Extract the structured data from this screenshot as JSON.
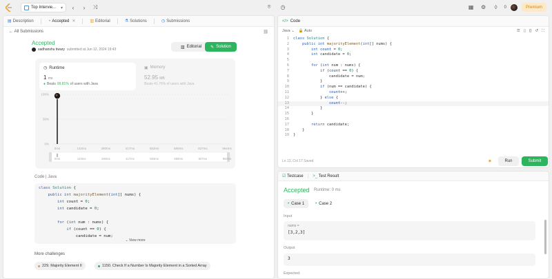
{
  "topbar": {
    "tab_title": "Top Intervie...",
    "premium_label": "Premium"
  },
  "left": {
    "tabs": [
      {
        "label": "Description"
      },
      {
        "label": "Accepted"
      },
      {
        "label": "Editorial"
      },
      {
        "label": "Solutions"
      },
      {
        "label": "Submissions"
      }
    ],
    "back_label": "All Submissions",
    "status": "Accepted",
    "author": "sadhanshu tiwary",
    "submitted": "submitted at Jun 12, 2024 19:43",
    "editorial_btn": "Editorial",
    "solution_btn": "Solution",
    "runtime": {
      "label": "Runtime",
      "value": "1",
      "unit": "ms",
      "beats_prefix": "Beats",
      "beats_pct": "99.81%",
      "beats_suffix": "of users with Java"
    },
    "memory": {
      "label": "Memory",
      "value": "52.95",
      "unit": "MB",
      "beats_text": "Beats 41.76% of users with Java"
    },
    "code_label": "Code | Java",
    "code_lines": [
      "class Solution {",
      "    public int majorityElement(int[] nums) {",
      "        int count = 0;",
      "        int candidate = 0;",
      "",
      "        for (int num : nums) {",
      "            if (count == 0) {",
      "                candidate = num;"
    ],
    "view_more": "View more",
    "more_challenges": "More challenges",
    "challenges": [
      {
        "label": "229. Majority Element II",
        "color": "#e0a12a"
      },
      {
        "label": "1150. Check If a Number Is Majority Element in a Sorted Array",
        "color": "#2aa5a5"
      }
    ]
  },
  "chart_data": {
    "type": "bar",
    "title": "",
    "xlabel": "",
    "ylabel": "",
    "ylim": [
      0,
      100
    ],
    "yticks": [
      "100%",
      "50%",
      "0%"
    ],
    "categories": [
      "0ms",
      "143ms",
      "280ms",
      "417ms",
      "553ms",
      "690ms",
      "827ms",
      "964ms"
    ],
    "values": [
      99.8,
      0.1,
      0,
      0,
      0,
      0,
      0,
      0
    ],
    "range_ticks": [
      "0ms",
      "143ms",
      "280ms",
      "417ms",
      "553ms",
      "690ms",
      "827ms",
      "964ms"
    ]
  },
  "right": {
    "title": "Code",
    "language": "Java",
    "autosave": "Auto",
    "status": "Ln 13, Col 17   Saved",
    "run_btn": "Run",
    "submit_btn": "Submit"
  },
  "test": {
    "tab_testcase": "Testcase",
    "tab_result": "Test Result",
    "status": "Accepted",
    "runtime": "Runtime: 0 ms",
    "case1": "Case 1",
    "case2": "Case 2",
    "input_label": "Input",
    "input_key": "nums =",
    "input_value": "[3,2,3]",
    "output_label": "Output",
    "output_value": "3",
    "expected_label": "Expected"
  }
}
